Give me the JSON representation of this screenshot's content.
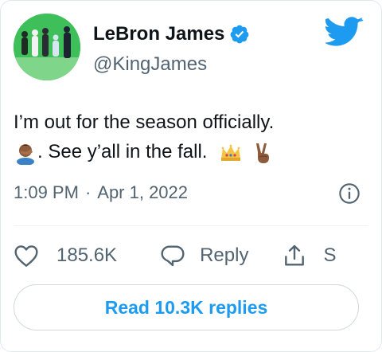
{
  "colors": {
    "brand_blue": "#1d9bf0",
    "text_primary": "#0f1419",
    "text_secondary": "#536471",
    "border": "#cfd9de",
    "avatar_green": "#41c25a"
  },
  "author": {
    "display_name": "LeBron James",
    "handle": "@KingJames",
    "verified": true,
    "avatar_icon": "profile-photo"
  },
  "header": {
    "logo_icon": "twitter-bird-icon"
  },
  "tweet": {
    "line1": "I’m out for the season officially.",
    "line2_text": ". See y’all in the fall.",
    "emojis": [
      "person-facepalming-emoji",
      "crown-emoji",
      "victory-hand-emoji"
    ],
    "time": "1:09 PM",
    "separator": "·",
    "date": "Apr 1, 2022",
    "info_icon": "info-icon"
  },
  "actions": {
    "like_icon": "heart-icon",
    "like_count": "185.6K",
    "reply_icon": "reply-bubble-icon",
    "reply_label": "Reply",
    "share_icon": "share-icon",
    "share_label": "S"
  },
  "footer": {
    "read_replies_label": "Read 10.3K replies"
  }
}
